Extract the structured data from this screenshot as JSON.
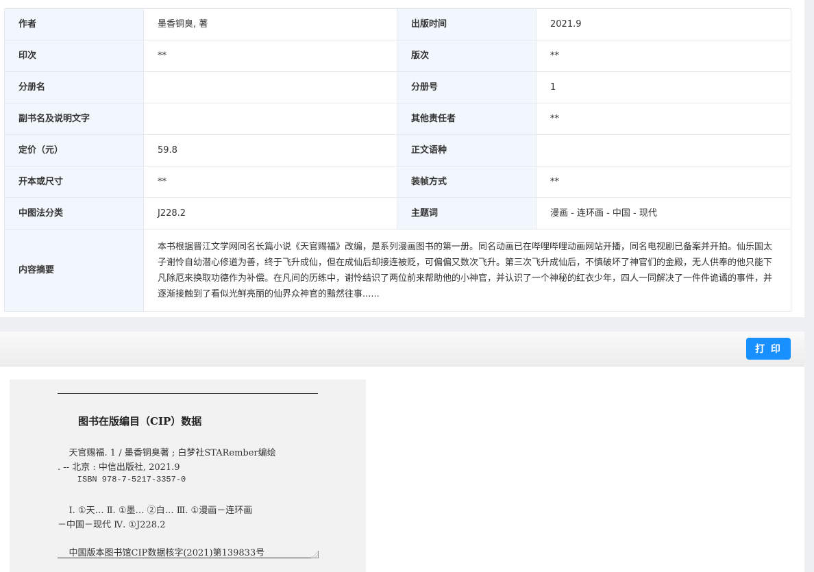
{
  "book_info": {
    "rows": [
      {
        "l1": "作者",
        "v1": "墨香铜臭, 著",
        "l2": "出版时间",
        "v2": "2021.9"
      },
      {
        "l1": "印次",
        "v1": "**",
        "l2": "版次",
        "v2": "**"
      },
      {
        "l1": "分册名",
        "v1": "",
        "l2": "分册号",
        "v2": "1"
      },
      {
        "l1": "副书名及说明文字",
        "v1": "",
        "l2": "其他责任者",
        "v2": "**"
      },
      {
        "l1": "定价（元）",
        "v1": "59.8",
        "l2": "正文语种",
        "v2": ""
      },
      {
        "l1": "开本或尺寸",
        "v1": "**",
        "l2": "装帧方式",
        "v2": "**"
      },
      {
        "l1": "中图法分类",
        "v1": "J228.2",
        "l2": "主题词",
        "v2": "漫画 - 连环画 - 中国 - 现代"
      }
    ],
    "summary_label": "内容摘要",
    "summary_text": "本书根据晋江文学网同名长篇小说《天官赐福》改编，是系列漫画图书的第一册。同名动画已在哔哩哔哩动画网站开播，同名电视剧已备案并开拍。仙乐国太子谢怜自幼潜心修道为善，终于飞升成仙，但在成仙后却接连被贬，可偏偏又数次飞升。第三次飞升成仙后，不慎破坏了神官们的金殿，无人供奉的他只能下凡除厄来换取功德作为补偿。在凡间的历练中，谢怜结识了两位前来帮助他的小神官，并认识了一个神秘的红衣少年，四人一同解决了一件件诡谲的事件，并逐渐接触到了看似光鲜亮丽的仙界众神官的黯然往事......"
  },
  "toolbar": {
    "print_label": "打 印"
  },
  "cip": {
    "title": "图书在版编目（CIP）数据",
    "line1": "    天官赐福. 1 / 墨香铜臭著 ; 白梦社STARember编绘",
    "line2": ". -- 北京 : 中信出版社, 2021.9",
    "line3": "    ISBN 978-7-5217-3357-0",
    "line4": "    Ⅰ. ①天… Ⅱ. ①墨… ②白… Ⅲ. ①漫画－连环画",
    "line5": "－中国－现代 Ⅳ. ①J228.2",
    "line6": "    中国版本图书馆CIP数据核字(2021)第139833号"
  }
}
